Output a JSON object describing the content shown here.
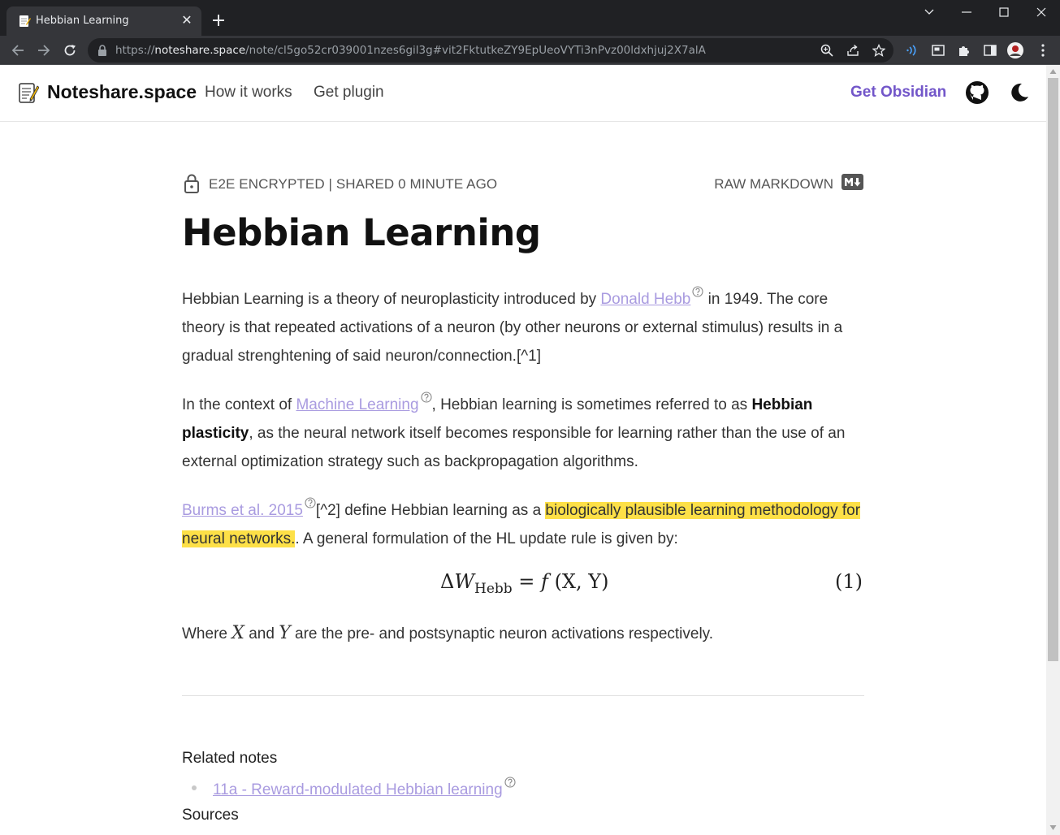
{
  "browser": {
    "tab_title": "Hebbian Learning",
    "url_scheme": "https://",
    "url_host": "noteshare.space",
    "url_path": "/note/cl5go52cr039001nzes6gil3g#vit2FktutkeZY9EpUeoVYTi3nPvz00ldxhjuj2X7alA"
  },
  "header": {
    "brand": "Noteshare.space",
    "nav": [
      "How it works",
      "Get plugin"
    ],
    "cta": "Get Obsidian"
  },
  "note": {
    "meta": "E2E ENCRYPTED | SHARED 0 MINUTE AGO",
    "raw_markdown": "RAW MARKDOWN",
    "title": "Hebbian Learning",
    "p1": {
      "t1": "Hebbian Learning is a theory of neuroplasticity introduced by ",
      "link": "Donald Hebb",
      "t2": " in 1949. The core theory is that repeated activations of a neuron (by other neurons or external stimulus) results in a gradual strenghtening of said neuron/connection.[^1]"
    },
    "p2": {
      "t1": "In the context of ",
      "link": "Machine Learning",
      "t2": ", Hebbian learning is sometimes referred to as ",
      "bold": "Hebbian plasticity",
      "t3": ", as the neural network itself becomes responsible for learning rather than the use of an external optimization strategy such as backpropagation algorithms."
    },
    "p3": {
      "link": "Burms et al. 2015",
      "t1": "[^2] define Hebbian learning as a ",
      "highlight": "biologically plausible learning methodology for neural networks.",
      "t2": ". A general formulation of the HL update rule is given by:"
    },
    "equation": {
      "delta": "Δ",
      "w": "W",
      "sub": "Hebb",
      "rhs_eq": " = ",
      "f": "f",
      "args": " (X, Y)",
      "number": "(1)"
    },
    "p4": {
      "t1": "Where ",
      "x": "X",
      "t2": " and ",
      "y": "Y",
      "t3": " are the pre- and postsynaptic neuron activations respectively."
    },
    "related_heading": "Related notes",
    "related_items": [
      "11a - Reward-modulated Hebbian learning"
    ],
    "sources_heading": "Sources"
  }
}
